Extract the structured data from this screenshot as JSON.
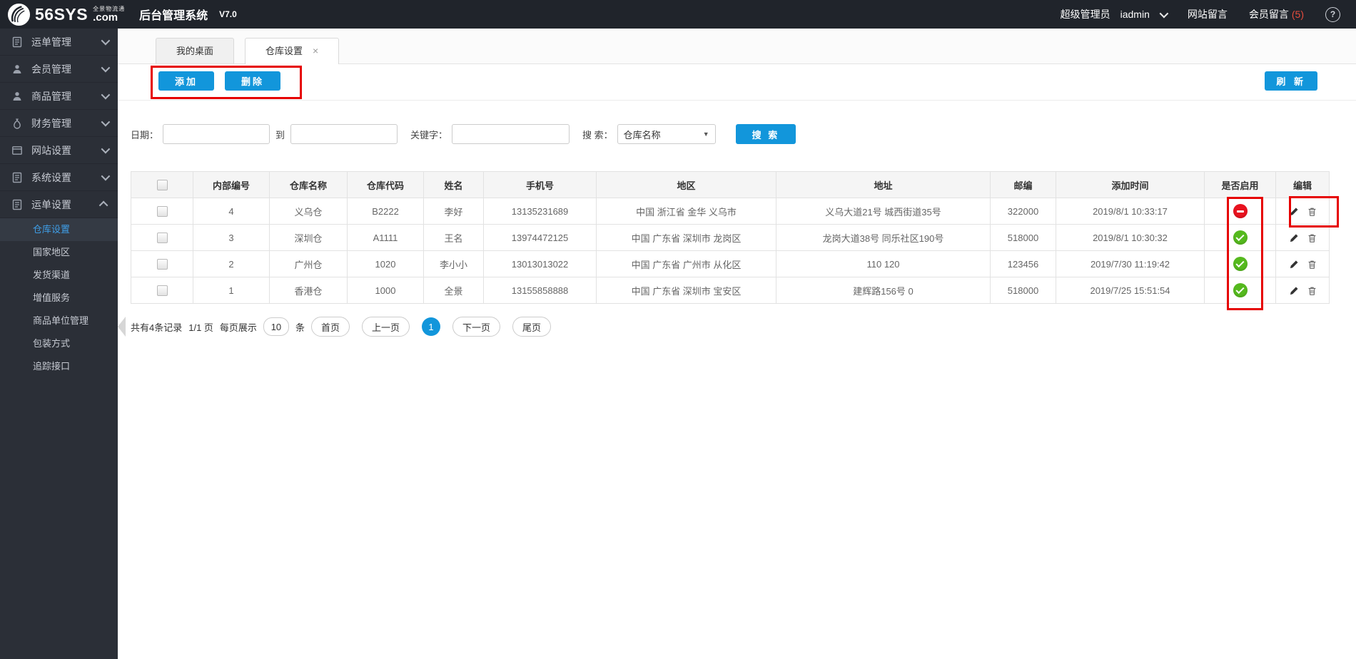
{
  "topbar": {
    "brand": "56SYS",
    "brand_tagline": "全景物流通",
    "brand_dotcom": ".com",
    "app_title": "后台管理系统",
    "version": "V7.0",
    "role": "超级管理员",
    "username": "iadmin",
    "site_messages": "网站留言",
    "member_messages": "会员留言",
    "member_messages_count": "(5)",
    "help": "?"
  },
  "sidebar": {
    "items": [
      {
        "label": "运单管理",
        "icon": "waybill-doc-icon",
        "state": "collapsed"
      },
      {
        "label": "会员管理",
        "icon": "user-icon",
        "state": "collapsed"
      },
      {
        "label": "商品管理",
        "icon": "user-icon",
        "state": "collapsed"
      },
      {
        "label": "财务管理",
        "icon": "finance-icon",
        "state": "collapsed"
      },
      {
        "label": "网站设置",
        "icon": "browser-icon",
        "state": "collapsed"
      },
      {
        "label": "系统设置",
        "icon": "waybill-doc-icon",
        "state": "collapsed"
      },
      {
        "label": "运单设置",
        "icon": "waybill-doc-icon",
        "state": "expanded"
      }
    ],
    "submenu": {
      "items": [
        "仓库设置",
        "国家地区",
        "发货渠道",
        "增值服务",
        "商品单位管理",
        "包装方式",
        "追踪接口"
      ],
      "active_index": 0
    }
  },
  "tabs": [
    {
      "label": "我的桌面",
      "closable": false,
      "active": false
    },
    {
      "label": "仓库设置",
      "closable": true,
      "active": true,
      "close_glyph": "×"
    }
  ],
  "toolbar": {
    "add_label": "添加",
    "delete_label": "删除",
    "refresh_label": "刷 新"
  },
  "filters": {
    "date_label": "日期：",
    "to_label": "到",
    "keyword_label": "关键字：",
    "search_label": "搜 索：",
    "search_type_selected": "仓库名称",
    "search_button": "搜 索"
  },
  "table": {
    "headers": [
      "内部编号",
      "仓库名称",
      "仓库代码",
      "姓名",
      "手机号",
      "地区",
      "地址",
      "邮编",
      "添加时间",
      "是否启用",
      "编辑"
    ],
    "rows": [
      {
        "id": "4",
        "name": "义乌仓",
        "code": "B2222",
        "contact": "李好",
        "phone": "13135231689",
        "region": "中国 浙江省 金华 义乌市",
        "address": "义乌大道21号 城西街道35号",
        "zip": "322000",
        "time": "2019/8/1 10:33:17",
        "enabled": false
      },
      {
        "id": "3",
        "name": "深圳仓",
        "code": "A1111",
        "contact": "王名",
        "phone": "13974472125",
        "region": "中国 广东省 深圳市 龙岗区",
        "address": "龙岗大道38号 同乐社区190号",
        "zip": "518000",
        "time": "2019/8/1 10:30:32",
        "enabled": true
      },
      {
        "id": "2",
        "name": "广州仓",
        "code": "1020",
        "contact": "李小小",
        "phone": "13013013022",
        "region": "中国 广东省 广州市 从化区",
        "address": "110 120",
        "zip": "123456",
        "time": "2019/7/30 11:19:42",
        "enabled": true
      },
      {
        "id": "1",
        "name": "香港仓",
        "code": "1000",
        "contact": "全景",
        "phone": "13155858888",
        "region": "中国 广东省 深圳市 宝安区",
        "address": "建辉路156号 0",
        "zip": "518000",
        "time": "2019/7/25 15:51:54",
        "enabled": true
      }
    ]
  },
  "pagination": {
    "summary": "共有4条记录",
    "page_info": "1/1 页",
    "per_page_label": "每页展示",
    "per_page": "10",
    "per_page_unit": "条",
    "first": "首页",
    "prev": "上一页",
    "current": "1",
    "next": "下一页",
    "last": "尾页"
  },
  "colors": {
    "accent_blue": "#1296db",
    "annotation_red": "#e60000",
    "enabled_green": "#55b91e",
    "disabled_red": "#e8121f",
    "topbar_bg": "#20242b",
    "sidebar_bg": "#2b2f37"
  }
}
